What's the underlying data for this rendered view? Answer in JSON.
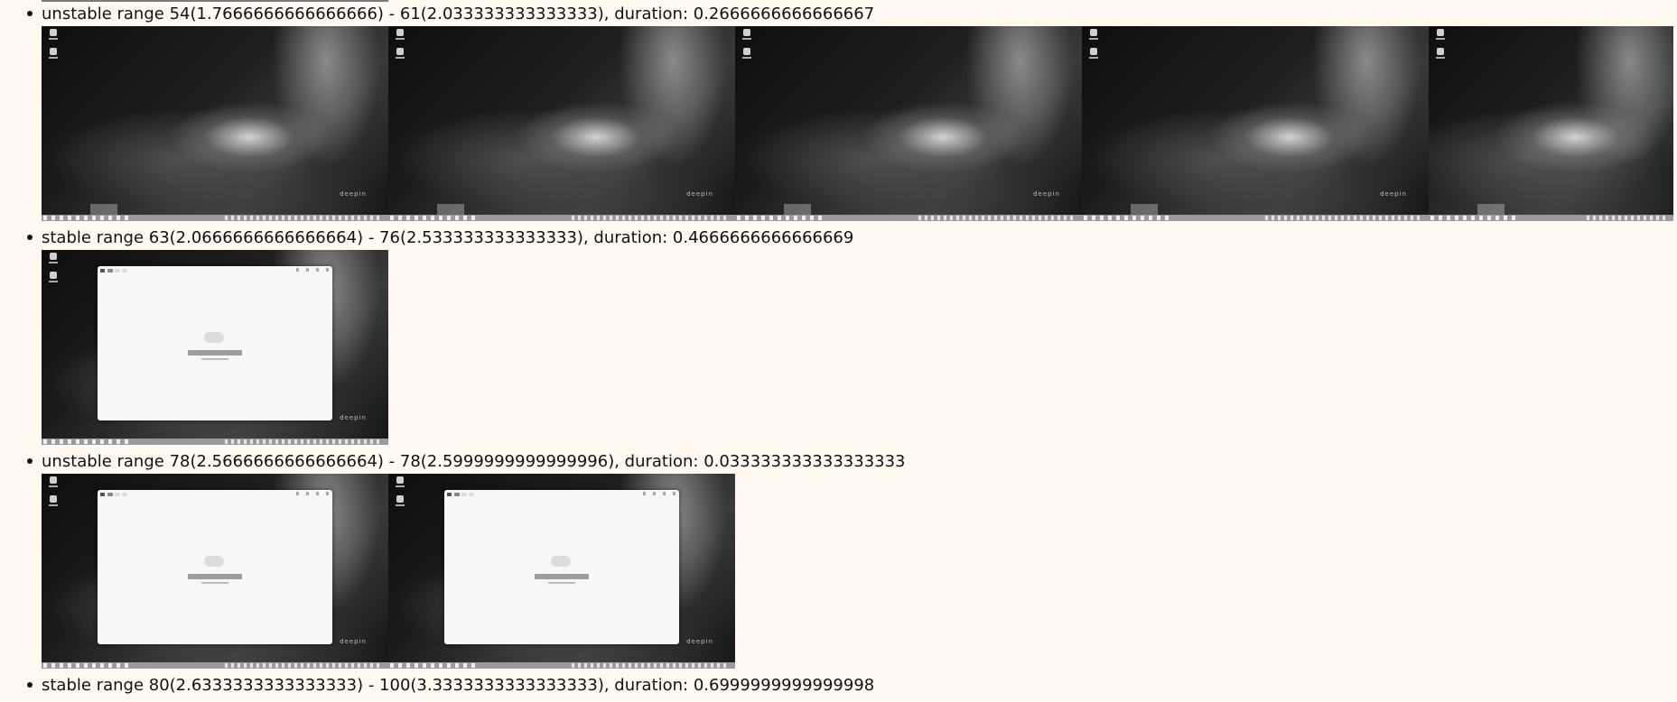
{
  "ranges": [
    {
      "label": "unstable range 54(1.7666666666666666) - 61(2.033333333333333), duration: 0.2666666666666667",
      "frames": [
        {
          "desktop_icons": [
            "computer-icon",
            "trash-icon"
          ],
          "watermark": "deepin",
          "window_open": false
        },
        {
          "desktop_icons": [
            "computer-icon",
            "trash-icon"
          ],
          "watermark": "deepin",
          "window_open": false
        },
        {
          "desktop_icons": [
            "computer-icon",
            "trash-icon"
          ],
          "watermark": "deepin",
          "window_open": false
        },
        {
          "desktop_icons": [
            "computer-icon",
            "trash-icon"
          ],
          "watermark": "deepin",
          "window_open": false
        },
        {
          "desktop_icons": [
            "computer-icon",
            "trash-icon"
          ],
          "watermark": "",
          "window_open": false
        }
      ]
    },
    {
      "label": "stable range 63(2.0666666666666664) - 76(2.533333333333333), duration: 0.4666666666666669",
      "frames": [
        {
          "desktop_icons": [
            "computer-icon",
            "trash-icon"
          ],
          "watermark": "deepin",
          "window_open": true
        }
      ]
    },
    {
      "label": "unstable range 78(2.5666666666666664) - 78(2.5999999999999996), duration: 0.033333333333333333",
      "frames": [
        {
          "desktop_icons": [
            "computer-icon",
            "trash-icon"
          ],
          "watermark": "deepin",
          "window_open": true
        },
        {
          "desktop_icons": [
            "computer-icon",
            "trash-icon"
          ],
          "watermark": "deepin",
          "window_open": true
        }
      ]
    },
    {
      "label": "stable range 80(2.6333333333333333) - 100(3.3333333333333333), duration: 0.6999999999999998",
      "frames": []
    }
  ],
  "colors": {
    "page_background": "#fff9f2",
    "text": "#111111",
    "taskbar": "#9a9a9a"
  }
}
